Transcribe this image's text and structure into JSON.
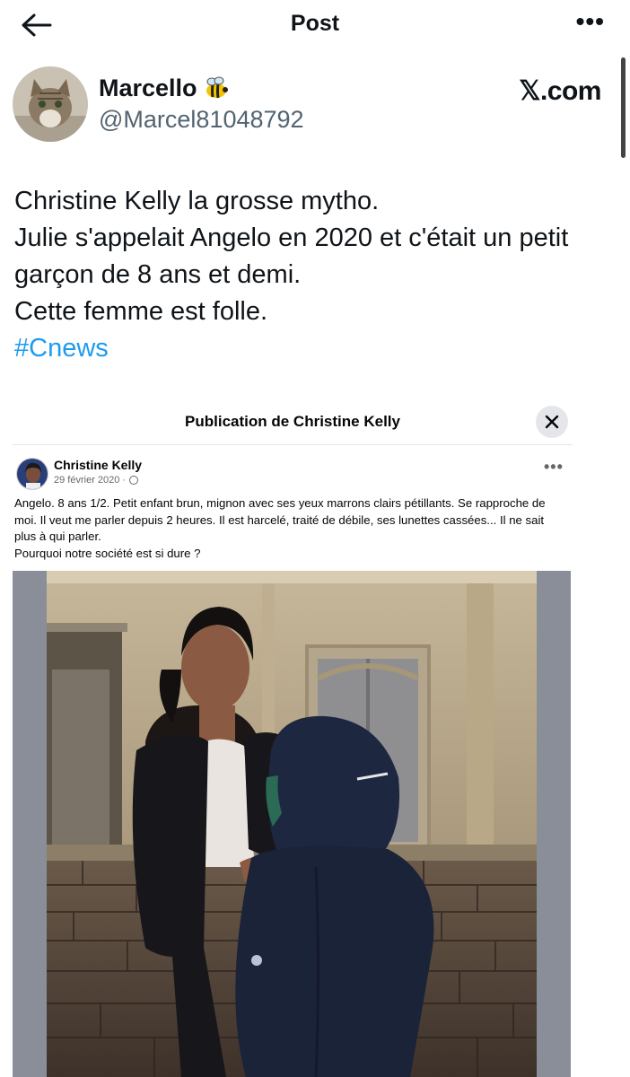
{
  "header": {
    "title": "Post",
    "more_label": "•••"
  },
  "author": {
    "name": "Marcello",
    "handle": "@Marcel81048792"
  },
  "brand": {
    "label": "𝕏.com"
  },
  "tweet": {
    "lines": [
      "Christine Kelly la grosse mytho.",
      "Julie s'appelait Angelo en 2020 et c'était un petit",
      "garçon de 8 ans et demi.",
      "Cette femme est folle."
    ],
    "hashtag": "#Cnews"
  },
  "embed": {
    "title": "Publication de Christine Kelly",
    "close_label": "✕",
    "author_name": "Christine Kelly",
    "date": "29 février 2020 · ",
    "more_label": "•••",
    "text_lines": [
      "Angelo. 8 ans 1/2. Petit enfant brun, mignon avec ses yeux marrons clairs pétillants. Se rapproche de",
      "moi. Il veut me parler depuis 2 heures. Il est harcelé, traité de débile, ses lunettes cassées... Il ne sait",
      "plus à qui parler.",
      "Pourquoi notre société est si dure ?"
    ]
  },
  "colors": {
    "accent": "#1d9bf0",
    "secondary_text": "#536471",
    "photo_frame": "#8a8e99"
  },
  "icons": {
    "back": "arrow-left-icon",
    "more": "more-horizontal-icon",
    "bee": "bee-emoji",
    "close": "close-icon",
    "globe": "globe-icon"
  }
}
